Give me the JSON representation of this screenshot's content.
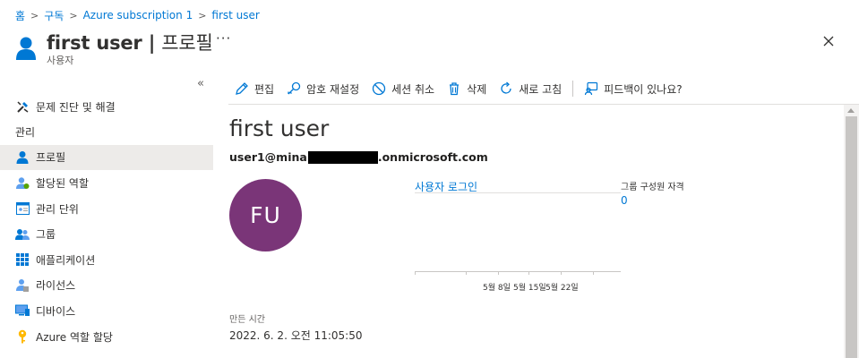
{
  "breadcrumb": {
    "items": [
      "홈",
      "구독",
      "Azure subscription 1",
      "first user"
    ],
    "separator": ">"
  },
  "header": {
    "title_name": "first user",
    "title_sep": " | ",
    "title_section": "프로필",
    "subtitle": "사용자",
    "more": "···",
    "icon": "user-icon"
  },
  "sidebar": {
    "collapse": "«",
    "items": [
      {
        "label": "문제 진단 및 해결",
        "icon": "wrench-icon"
      },
      {
        "section": "관리"
      },
      {
        "label": "프로필",
        "icon": "profile-icon",
        "active": true
      },
      {
        "label": "할당된 역할",
        "icon": "assigned-roles-icon"
      },
      {
        "label": "관리 단위",
        "icon": "admin-unit-icon"
      },
      {
        "label": "그룹",
        "icon": "groups-icon"
      },
      {
        "label": "애플리케이션",
        "icon": "applications-icon"
      },
      {
        "label": "라이선스",
        "icon": "licenses-icon"
      },
      {
        "label": "디바이스",
        "icon": "devices-icon"
      },
      {
        "label": "Azure 역할 할당",
        "icon": "key-icon"
      }
    ]
  },
  "toolbar": {
    "edit": "편집",
    "reset_password": "암호 재설정",
    "revoke_sessions": "세션 취소",
    "delete": "삭제",
    "refresh": "새로 고침",
    "feedback": "피드백이 있나요?"
  },
  "profile": {
    "name": "first user",
    "upn_prefix": "user1@mina",
    "upn_suffix": ".onmicrosoft.com",
    "initials": "FU",
    "avatar_color": "#7a3578"
  },
  "signins": {
    "link": "사용자 로그인",
    "ticks": [
      "5월 8일",
      "5월 15일",
      "5월 22일"
    ]
  },
  "groups": {
    "title": "그룹 구성원 자격",
    "value": "0"
  },
  "created": {
    "label": "만든 시간",
    "value": "2022. 6. 2. 오전 11:05:50"
  },
  "colors": {
    "accent": "#0078d4",
    "active_bg": "#edebe9"
  }
}
